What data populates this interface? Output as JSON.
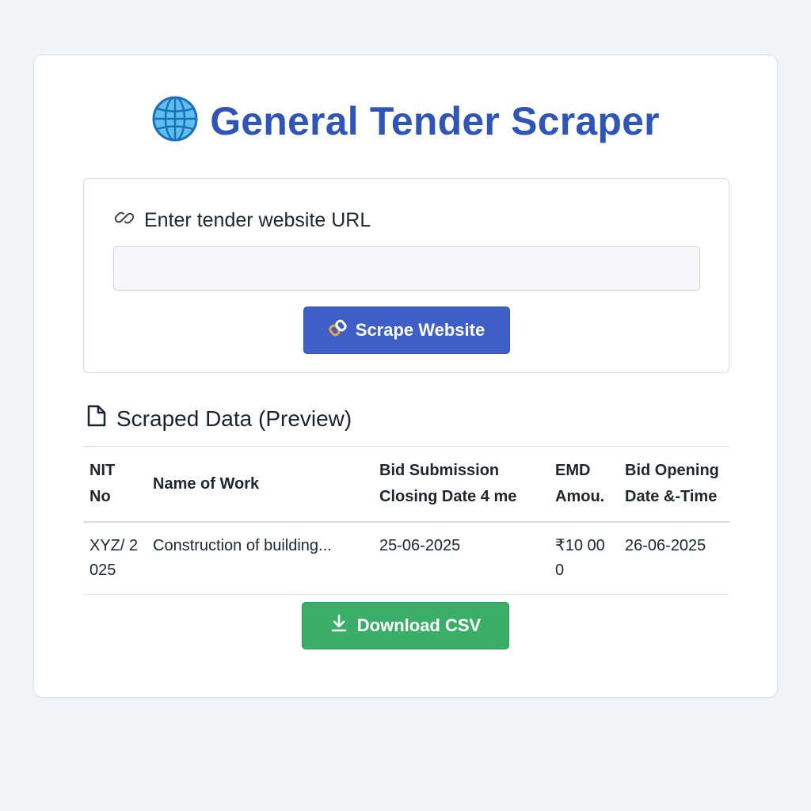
{
  "app": {
    "title": "General Tender Scraper",
    "title_icon": "globe-icon",
    "accent_color": "#2f55b8"
  },
  "url_form": {
    "label": "Enter tender website URL",
    "label_icon": "link-icon",
    "input_value": "",
    "input_placeholder": "",
    "scrape_button_label": "Scrape Website",
    "scrape_button_icon": "link-chain-icon",
    "scrape_button_color": "#3e5fc6"
  },
  "preview": {
    "heading": "Scraped Data (Preview)",
    "heading_icon": "document-icon",
    "columns": [
      "NIT No",
      "Name of Work",
      "Bid Submission Closing Date 4 me",
      "EMD Amou.",
      "Bid Opening Date &-Time"
    ],
    "rows": [
      {
        "nit_no": "XYZ/ 2025",
        "name_of_work": "Construction of building...",
        "bid_closing": "25-06-2025",
        "emd_amount": "₹10 000",
        "bid_opening": "26-06-2025"
      }
    ]
  },
  "download": {
    "label": "Download CSV",
    "icon": "download-icon",
    "color": "#3bae6a"
  }
}
